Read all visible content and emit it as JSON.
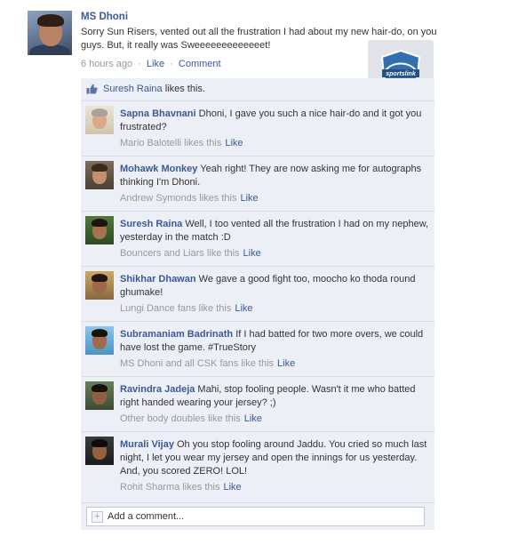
{
  "post": {
    "author": "MS Dhoni",
    "text": "Sorry Sun Risers, vented out all the frustration I had about my new hair-do, on you guys. But, it really was Sweeeeeeeeeeeeet!",
    "time": "6 hours ago",
    "like_label": "Like",
    "comment_label": "Comment"
  },
  "watermark": {
    "text": "sportslink"
  },
  "likes": {
    "who": "Suresh Raina",
    "rest": " likes this."
  },
  "comments": [
    {
      "name": "Sapna Bhavnani",
      "text": " Dhoni, I gave you such a nice hair-do and it got you frustrated?",
      "likes": "Mario Balotelli likes this",
      "like_label": "Like"
    },
    {
      "name": "Mohawk Monkey",
      "text": " Yeah right! They are now asking me for autographs thinking I'm Dhoni.",
      "likes": "Andrew Symonds likes this",
      "like_label": "Like"
    },
    {
      "name": "Suresh Raina",
      "text": " Well, I too vented all the frustration I had on my nephew, yesterday in the match :D",
      "likes": "Bouncers and Liars like this",
      "like_label": "Like"
    },
    {
      "name": "Shikhar Dhawan",
      "text": " We gave a good fight too, moocho ko thoda round ghumake!",
      "likes": "Lungi Dance fans like this",
      "like_label": "Like"
    },
    {
      "name": "Subramaniam Badrinath",
      "text": " If I had batted for two more overs, we could have lost the game. #TrueStory",
      "likes": "MS Dhoni and all CSK fans like this",
      "like_label": "Like"
    },
    {
      "name": "Ravindra Jadeja",
      "text": " Mahi, stop fooling people. Wasn't it me who batted right handed wearing your jersey? ;)",
      "likes": "Other body doubles like this",
      "like_label": "Like"
    },
    {
      "name": "Murali Vijay",
      "text": " Oh you stop fooling around Jaddu. You cried so much last night, I let you wear my jersey and open the innings for us yesterday. And, you scored ZERO! LOL!",
      "likes": "Rohit Sharma likes this",
      "like_label": "Like"
    }
  ],
  "add_comment": {
    "placeholder": "Add a comment..."
  },
  "colors": {
    "link": "#3b5998",
    "panel": "#eceff5",
    "border": "#d8dfea",
    "muted": "#999999"
  }
}
